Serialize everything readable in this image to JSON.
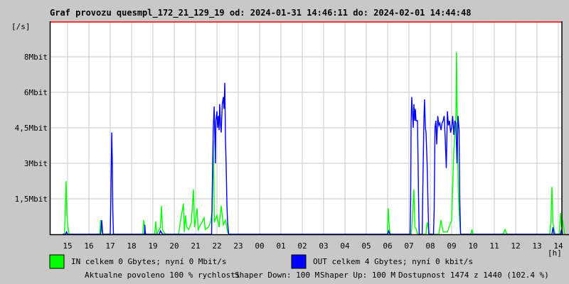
{
  "chart_data": {
    "type": "line",
    "title": "Graf provozu quesmpl_172_21_129_19 od: 2024-01-31 14:46:11 do: 2024-02-01 14:44:48",
    "ylabel": "[/s]",
    "xlabel": "[h]",
    "y_unit": "Mbit",
    "ylim": [
      0,
      9
    ],
    "y_ticks": [
      "1,5Mbit",
      "3Mbit",
      "4,5Mbit",
      "6Mbit",
      "8Mbit"
    ],
    "x_ticks": [
      {
        "label": "15",
        "h": 15
      },
      {
        "label": "16",
        "h": 16
      },
      {
        "label": "17",
        "h": 17
      },
      {
        "label": "18",
        "h": 18
      },
      {
        "label": "19",
        "h": 19
      },
      {
        "label": "20",
        "h": 20
      },
      {
        "label": "21",
        "h": 21
      },
      {
        "label": "22",
        "h": 22
      },
      {
        "label": "23",
        "h": 23
      },
      {
        "label": "00",
        "h": 24
      },
      {
        "label": "01",
        "h": 25
      },
      {
        "label": "02",
        "h": 26
      },
      {
        "label": "03",
        "h": 27
      },
      {
        "label": "04",
        "h": 28
      },
      {
        "label": "05",
        "h": 29
      },
      {
        "label": "06",
        "h": 30
      },
      {
        "label": "07",
        "h": 31
      },
      {
        "label": "08",
        "h": 32
      },
      {
        "label": "09",
        "h": 33
      },
      {
        "label": "10",
        "h": 34
      },
      {
        "label": "11",
        "h": 35
      },
      {
        "label": "12",
        "h": 36
      },
      {
        "label": "13",
        "h": 37
      },
      {
        "label": "14",
        "h": 38
      }
    ],
    "grid": true,
    "series": [
      {
        "name": "IN",
        "color": "#00ff00",
        "points": [
          [
            14.77,
            0
          ],
          [
            14.85,
            0
          ],
          [
            14.88,
            0.5
          ],
          [
            14.9,
            1.4
          ],
          [
            14.93,
            2.25
          ],
          [
            14.97,
            0.8
          ],
          [
            15.02,
            0.3
          ],
          [
            15.07,
            0
          ],
          [
            16.5,
            0
          ],
          [
            16.55,
            0.6
          ],
          [
            16.6,
            0.2
          ],
          [
            16.65,
            0
          ],
          [
            18.52,
            0
          ],
          [
            18.57,
            0.6
          ],
          [
            18.62,
            0.2
          ],
          [
            18.67,
            0
          ],
          [
            19.08,
            0
          ],
          [
            19.13,
            0.55
          ],
          [
            19.18,
            0
          ],
          [
            19.35,
            0.3
          ],
          [
            19.4,
            1.2
          ],
          [
            19.45,
            0.2
          ],
          [
            19.5,
            0.1
          ],
          [
            19.6,
            0
          ],
          [
            20.2,
            0
          ],
          [
            20.3,
            0.6
          ],
          [
            20.43,
            1.3
          ],
          [
            20.47,
            0.1
          ],
          [
            20.53,
            0.8
          ],
          [
            20.58,
            0.3
          ],
          [
            20.68,
            0.2
          ],
          [
            20.8,
            0.5
          ],
          [
            20.9,
            1.9
          ],
          [
            20.95,
            0.3
          ],
          [
            21.07,
            1.1
          ],
          [
            21.12,
            0.2
          ],
          [
            21.4,
            0.7
          ],
          [
            21.45,
            0.2
          ],
          [
            21.6,
            0.3
          ],
          [
            21.7,
            0.5
          ],
          [
            21.78,
            1.0
          ],
          [
            21.83,
            4.0
          ],
          [
            21.88,
            0.5
          ],
          [
            22.0,
            0.8
          ],
          [
            22.1,
            0.3
          ],
          [
            22.2,
            1.2
          ],
          [
            22.3,
            0.4
          ],
          [
            22.4,
            0.6
          ],
          [
            22.5,
            0.1
          ],
          [
            22.55,
            0
          ],
          [
            29.98,
            0
          ],
          [
            30.03,
            1.1
          ],
          [
            30.07,
            0.4
          ],
          [
            30.12,
            0
          ],
          [
            31.1,
            0
          ],
          [
            31.15,
            0.5
          ],
          [
            31.23,
            1.9
          ],
          [
            31.28,
            0.3
          ],
          [
            31.35,
            0.2
          ],
          [
            31.4,
            0
          ],
          [
            31.8,
            0
          ],
          [
            31.85,
            0.5
          ],
          [
            31.9,
            0.3
          ],
          [
            31.95,
            0
          ],
          [
            32.4,
            0
          ],
          [
            32.5,
            0.6
          ],
          [
            32.6,
            0.1
          ],
          [
            32.8,
            0.1
          ],
          [
            33.0,
            0.6
          ],
          [
            33.1,
            3.5
          ],
          [
            33.2,
            5.0
          ],
          [
            33.23,
            7.7
          ],
          [
            33.27,
            4.0
          ],
          [
            33.32,
            1.5
          ],
          [
            33.38,
            0.5
          ],
          [
            33.42,
            0
          ],
          [
            33.9,
            0
          ],
          [
            33.95,
            0.2
          ],
          [
            34.0,
            0
          ],
          [
            35.4,
            0
          ],
          [
            35.5,
            0.2
          ],
          [
            35.6,
            0
          ],
          [
            37.6,
            0
          ],
          [
            37.65,
            0.5
          ],
          [
            37.7,
            2.0
          ],
          [
            37.75,
            0.5
          ],
          [
            37.8,
            0.2
          ],
          [
            37.85,
            0
          ],
          [
            38.05,
            0
          ],
          [
            38.1,
            0.9
          ],
          [
            38.15,
            0.3
          ],
          [
            38.2,
            0.6
          ],
          [
            38.3,
            0
          ]
        ]
      },
      {
        "name": "OUT",
        "color": "#0000ff",
        "points": [
          [
            14.77,
            0
          ],
          [
            14.9,
            0
          ],
          [
            14.95,
            0.1
          ],
          [
            15.0,
            0
          ],
          [
            16.55,
            0
          ],
          [
            16.6,
            0.6
          ],
          [
            16.65,
            0
          ],
          [
            17.0,
            0
          ],
          [
            17.03,
            1.5
          ],
          [
            17.05,
            3.0
          ],
          [
            17.07,
            4.3
          ],
          [
            17.1,
            2.9
          ],
          [
            17.12,
            1.0
          ],
          [
            17.15,
            0
          ],
          [
            18.6,
            0
          ],
          [
            18.62,
            0.4
          ],
          [
            18.65,
            0
          ],
          [
            19.3,
            0
          ],
          [
            19.35,
            0.15
          ],
          [
            19.45,
            0
          ],
          [
            21.75,
            0
          ],
          [
            21.8,
            3.0
          ],
          [
            21.83,
            4.5
          ],
          [
            21.87,
            5.4
          ],
          [
            21.9,
            4.2
          ],
          [
            21.93,
            3.0
          ],
          [
            21.95,
            4.8
          ],
          [
            22.0,
            5.2
          ],
          [
            22.03,
            4.5
          ],
          [
            22.07,
            5.0
          ],
          [
            22.1,
            4.4
          ],
          [
            22.13,
            5.5
          ],
          [
            22.17,
            4.6
          ],
          [
            22.2,
            4.3
          ],
          [
            22.25,
            5.5
          ],
          [
            22.3,
            5.8
          ],
          [
            22.33,
            5.3
          ],
          [
            22.37,
            6.4
          ],
          [
            22.4,
            4.0
          ],
          [
            22.43,
            3.0
          ],
          [
            22.47,
            1.2
          ],
          [
            22.5,
            0.5
          ],
          [
            22.55,
            0
          ],
          [
            30.0,
            0
          ],
          [
            30.05,
            0.15
          ],
          [
            30.1,
            0
          ],
          [
            31.05,
            0
          ],
          [
            31.08,
            1.5
          ],
          [
            31.1,
            4.7
          ],
          [
            31.13,
            5.8
          ],
          [
            31.17,
            5.0
          ],
          [
            31.2,
            4.5
          ],
          [
            31.23,
            5.5
          ],
          [
            31.27,
            4.8
          ],
          [
            31.3,
            5.3
          ],
          [
            31.33,
            4.8
          ],
          [
            31.4,
            4.8
          ],
          [
            31.45,
            1.5
          ],
          [
            31.48,
            0
          ],
          [
            31.62,
            0
          ],
          [
            31.65,
            2.0
          ],
          [
            31.7,
            4.8
          ],
          [
            31.73,
            5.7
          ],
          [
            31.77,
            4.5
          ],
          [
            31.8,
            4.3
          ],
          [
            31.85,
            3.0
          ],
          [
            31.9,
            1.0
          ],
          [
            31.93,
            0
          ],
          [
            32.15,
            0
          ],
          [
            32.18,
            1.0
          ],
          [
            32.22,
            4.5
          ],
          [
            32.26,
            4.8
          ],
          [
            32.3,
            3.8
          ],
          [
            32.35,
            5.0
          ],
          [
            32.4,
            4.6
          ],
          [
            32.45,
            4.7
          ],
          [
            32.5,
            4.4
          ],
          [
            32.55,
            4.7
          ],
          [
            32.6,
            4.8
          ],
          [
            32.65,
            5.0
          ],
          [
            32.7,
            4.0
          ],
          [
            32.75,
            2.8
          ],
          [
            32.8,
            5.2
          ],
          [
            32.85,
            4.6
          ],
          [
            32.9,
            4.8
          ],
          [
            32.95,
            4.3
          ],
          [
            33.0,
            4.5
          ],
          [
            33.05,
            5.0
          ],
          [
            33.1,
            4.2
          ],
          [
            33.15,
            4.8
          ],
          [
            33.2,
            4.7
          ],
          [
            33.25,
            3.0
          ],
          [
            33.3,
            5.0
          ],
          [
            33.35,
            4.4
          ],
          [
            33.38,
            1.5
          ],
          [
            33.42,
            0
          ],
          [
            37.7,
            0
          ],
          [
            37.75,
            0.3
          ],
          [
            37.8,
            0
          ],
          [
            38.1,
            0
          ],
          [
            38.15,
            0.2
          ],
          [
            38.2,
            0
          ]
        ]
      }
    ]
  },
  "legend": {
    "in_text": "IN celkem 0 Gbytes; nyní 0 Mbit/s",
    "out_text": "OUT celkem 4 Gbytes; nyní 0 kbit/s",
    "in_color": "#00ff00",
    "out_color": "#0000ff"
  },
  "status": {
    "allowed": "Aktualne povoleno 100 % rychlosti",
    "shaper_down": "Shaper Down: 100 M",
    "shaper_up": "Shaper Up: 100 M",
    "availability": "Dostupnost 1474 z 1440 (102.4 %)",
    "allowed_color": "#ff0000",
    "shaper_up_color": "#800080"
  }
}
